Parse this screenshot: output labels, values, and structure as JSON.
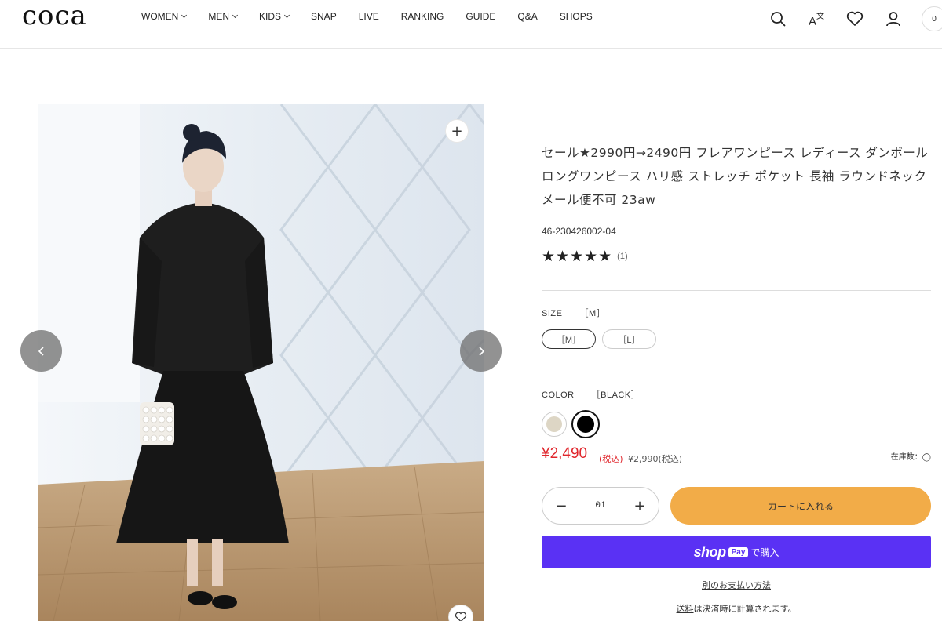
{
  "header": {
    "logo": "coca",
    "nav": [
      {
        "label": "WOMEN",
        "dropdown": true
      },
      {
        "label": "MEN",
        "dropdown": true
      },
      {
        "label": "KIDS",
        "dropdown": true
      },
      {
        "label": "SNAP",
        "dropdown": false
      },
      {
        "label": "LIVE",
        "dropdown": false
      },
      {
        "label": "RANKING",
        "dropdown": false
      },
      {
        "label": "GUIDE",
        "dropdown": false
      },
      {
        "label": "Q&A",
        "dropdown": false
      },
      {
        "label": "SHOPS",
        "dropdown": false
      }
    ],
    "icons": [
      "search-icon",
      "translate-icon",
      "heart-icon",
      "user-icon"
    ],
    "cart_count": "0"
  },
  "gallery": {
    "zoom_symbol": "+",
    "prev_icon": "chevron-left-icon",
    "next_icon": "chevron-right-icon",
    "favorite_icon": "heart-icon"
  },
  "product": {
    "title": "セール★2990円→2490円 フレアワンピース レディース ダンボール ロングワンピース ハリ感 ストレッチ ポケット 長袖 ラウンドネック メール便不可 23aw",
    "sku": "46-230426002-04",
    "stars": "★★★★★",
    "rating_count": "(1)",
    "size": {
      "label": "SIZE",
      "selected": "［M］",
      "options": [
        "［M］",
        "［L］"
      ]
    },
    "color": {
      "label": "COLOR",
      "selected": "［BLACK］",
      "swatches": [
        {
          "name": "beige",
          "hex": "#ddd6c5"
        },
        {
          "name": "black",
          "hex": "#000000"
        }
      ]
    },
    "price": "¥2,490",
    "tax_label": "(税込)",
    "old_price": "¥2,990(税込)",
    "stock": "在庫数：◯",
    "quantity": "01",
    "qty_minus": "−",
    "qty_plus": "+",
    "add_to_cart": "カートに入れる",
    "shop_pay_word": "shop",
    "shop_pay_badge": "Pay",
    "shop_pay_buy": "で購入",
    "alt_payment": "別のお支払い方法",
    "shipping_link": "送料",
    "shipping_note": "は決済時に計算されます。"
  },
  "colors": {
    "sale_red": "#e0262c",
    "cart_orange": "#f2ac48",
    "shop_pay_purple": "#5a31f4"
  }
}
